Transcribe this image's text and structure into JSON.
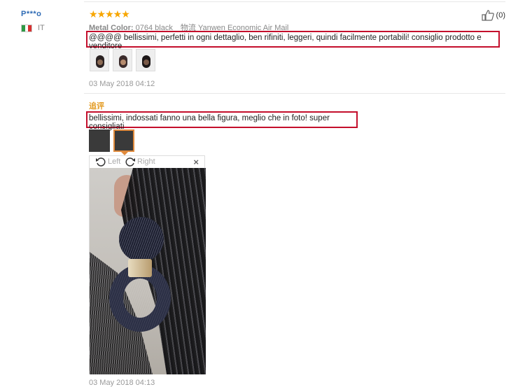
{
  "reviewer": {
    "name": "P***o",
    "country": "IT"
  },
  "review": {
    "stars": "★★★★★",
    "metal_label": "Metal Color:",
    "metal_value": "0764 black",
    "shipping_label": "物流",
    "shipping_value": "Yanwen Economic Air Mail",
    "text": "@@@@ bellissimi, perfetti in ogni dettaglio, ben rifiniti, leggeri, quindi facilmente portabili! consiglio prodotto e venditore",
    "date": "03 May 2018 04:12",
    "likes": "(0)"
  },
  "followup": {
    "label": "追评",
    "text": "bellissimi, indossati fanno una bella figura, meglio che in foto! super consigliati",
    "date": "03 May 2018 04:13"
  },
  "viewer": {
    "rotate_left": "Left",
    "rotate_right": "Right",
    "close": "×"
  },
  "colors": {
    "highlight": "#c40f2c",
    "stars": "#f7a600",
    "username": "#2d6ab4",
    "followup": "#e39a21"
  }
}
